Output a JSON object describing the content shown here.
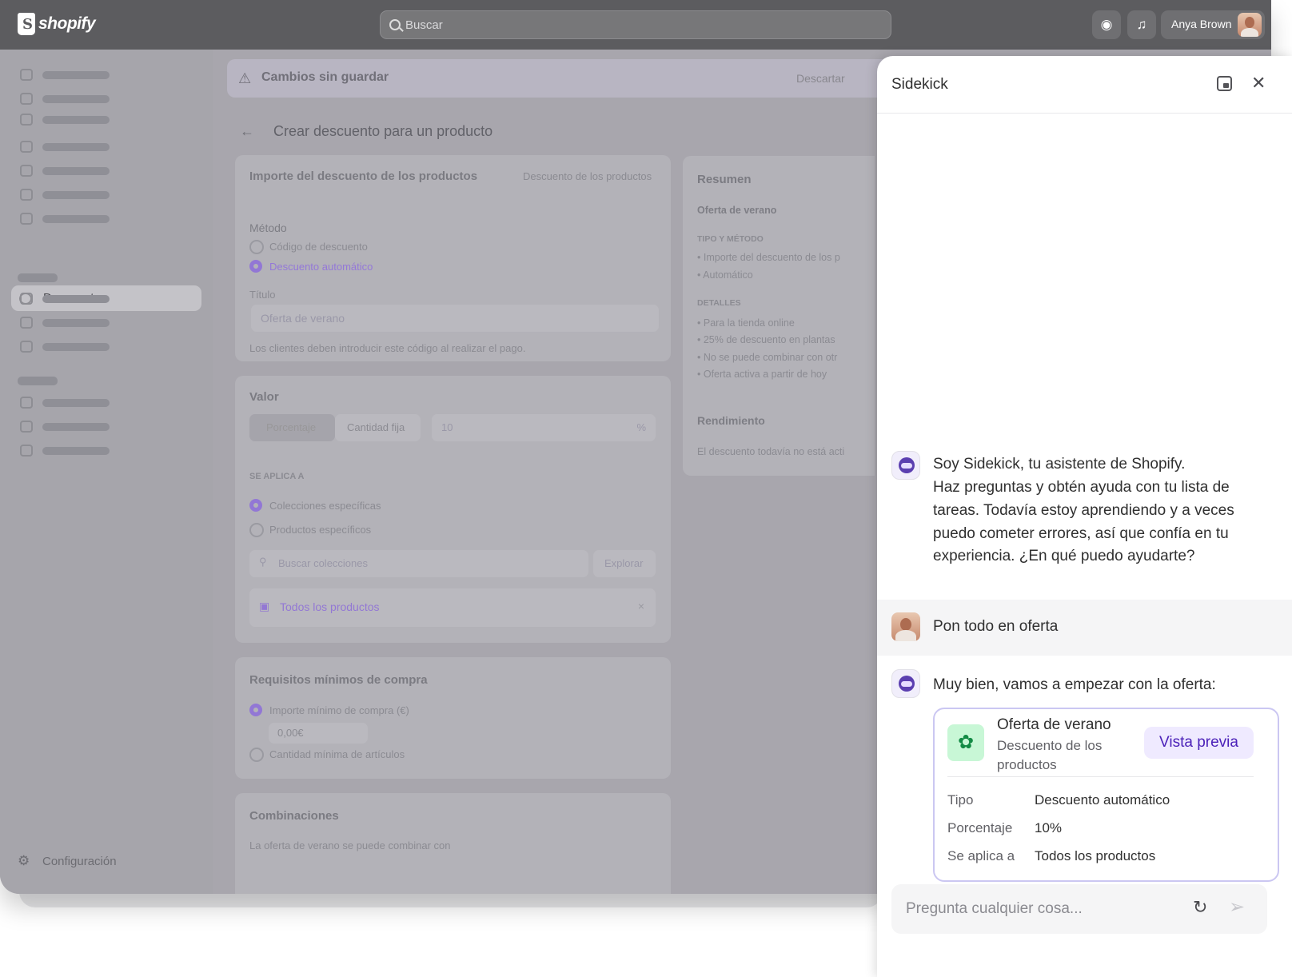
{
  "topbar": {
    "brand": "shopify",
    "search_placeholder": "Buscar",
    "user_name": "Anya Brown"
  },
  "sidebar": {
    "active_item": "Descuentos",
    "settings": "Configuración"
  },
  "unsaved": {
    "title": "Cambios sin guardar",
    "discard": "Descartar"
  },
  "page": {
    "title": "Crear descuento para un producto",
    "amount_card": {
      "title": "Importe del descuento de los productos",
      "type": "Descuento de los productos",
      "method_label": "Método",
      "method_code": "Código de descuento",
      "method_auto": "Descuento automático",
      "title_label": "Título",
      "title_value": "Oferta de verano",
      "help": "Los clientes deben introducir este código al realizar el pago."
    },
    "value_card": {
      "title": "Valor",
      "percent": "Porcentaje",
      "fixed": "Cantidad fija",
      "value": "10",
      "unit": "%",
      "applies_to": "SE APLICA A",
      "collections": "Colecciones específicas",
      "products": "Productos específicos",
      "search_placeholder": "Buscar colecciones",
      "browse": "Explorar",
      "all_products": "Todos los productos"
    },
    "min_card": {
      "title": "Requisitos mínimos de compra",
      "amount": "Importe mínimo de compra (€)",
      "amount_value": "0,00€",
      "qty": "Cantidad mínima de artículos"
    },
    "combo_card": {
      "title": "Combinaciones",
      "text": "La oferta de verano se puede combinar con"
    },
    "summary": {
      "title": "Resumen",
      "name": "Oferta de verano",
      "type_method": "TIPO Y MÉTODO",
      "tm1": "Importe del descuento de los p",
      "tm2": "Automático",
      "details": "DETALLES",
      "d1": "Para la tienda online",
      "d2": "25% de descuento en plantas",
      "d3": "No se puede combinar con otr",
      "d4": "Oferta activa a partir de hoy",
      "perf": "Rendimiento",
      "perf_text": "El descuento todavía no está acti"
    }
  },
  "sidekick": {
    "title": "Sidekick",
    "intro": [
      "Soy Sidekick, tu asistente de Shopify.",
      "Haz preguntas y obtén ayuda con tu lista de",
      "tareas. Todavía estoy aprendiendo y a veces",
      "puedo cometer errores, así que confía en tu",
      "experiencia. ¿En qué puedo ayudarte?"
    ],
    "user_message": "Pon todo en oferta",
    "reply": "Muy bien, vamos a empezar con la oferta:",
    "offer": {
      "title": "Oferta de verano",
      "subtitle": "Descuento de los productos",
      "preview": "Vista previa",
      "rows": [
        {
          "k": "Tipo",
          "v": "Descuento automático"
        },
        {
          "k": "Porcentaje",
          "v": "10%"
        },
        {
          "k": "Se aplica a",
          "v": "Todos los productos"
        }
      ]
    },
    "composer_placeholder": "Pregunta cualquier cosa..."
  }
}
